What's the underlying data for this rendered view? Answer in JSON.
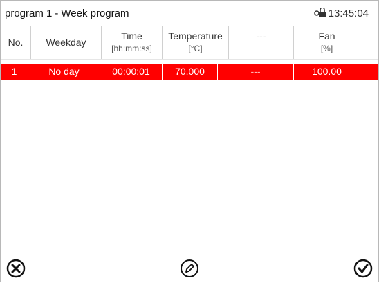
{
  "title": {
    "prefix": "program 1",
    "separator": "-",
    "main": "Week program"
  },
  "status": {
    "time": "13:45:04",
    "lock_icon": "lock-icon"
  },
  "columns": [
    {
      "line1": "No.",
      "line2": ""
    },
    {
      "line1": "Weekday",
      "line2": ""
    },
    {
      "line1": "Time",
      "line2": "[hh:mm:ss]"
    },
    {
      "line1": "Temperature",
      "line2": "[°C]"
    },
    {
      "line1": "---",
      "line2": ""
    },
    {
      "line1": "Fan",
      "line2": "[%]"
    }
  ],
  "rows": [
    {
      "no": "1",
      "weekday": "No day",
      "time": "00:00:01",
      "temperature": "70.000",
      "extra": "---",
      "fan": "100.00"
    }
  ],
  "toolbar": {
    "cancel_icon": "cancel-icon",
    "edit_icon": "edit-icon",
    "confirm_icon": "confirm-icon"
  },
  "colors": {
    "selected_row": "#ff0000",
    "row_text": "#ffffff"
  }
}
